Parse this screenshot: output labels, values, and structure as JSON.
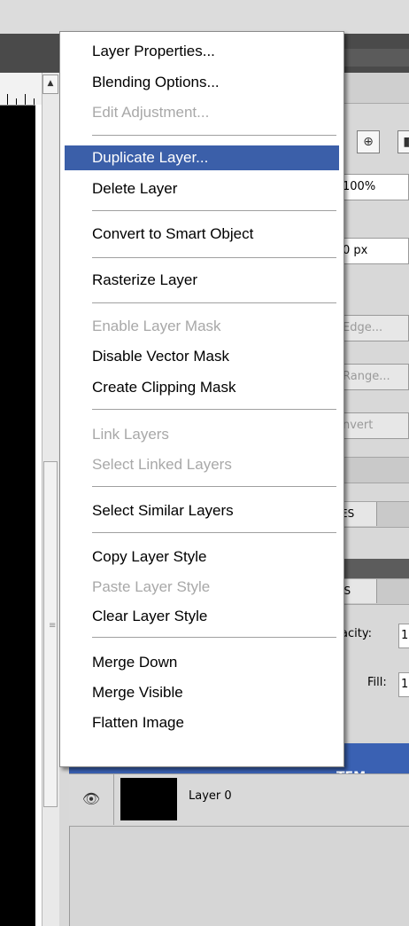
{
  "context_menu": {
    "items": [
      {
        "label": "Layer Properties...",
        "enabled": true
      },
      {
        "label": "Blending Options...",
        "enabled": true
      },
      {
        "label": "Edit Adjustment...",
        "enabled": false
      },
      {
        "label": "Duplicate Layer...",
        "enabled": true,
        "highlighted": true
      },
      {
        "label": "Delete Layer",
        "enabled": true
      },
      {
        "label": "Convert to Smart Object",
        "enabled": true
      },
      {
        "label": "Rasterize Layer",
        "enabled": true
      },
      {
        "label": "Enable Layer Mask",
        "enabled": false
      },
      {
        "label": "Disable Vector Mask",
        "enabled": true
      },
      {
        "label": "Create Clipping Mask",
        "enabled": true
      },
      {
        "label": "Link Layers",
        "enabled": false
      },
      {
        "label": "Select Linked Layers",
        "enabled": false
      },
      {
        "label": "Select Similar Layers",
        "enabled": true
      },
      {
        "label": "Copy Layer Style",
        "enabled": true
      },
      {
        "label": "Paste Layer Style",
        "enabled": false
      },
      {
        "label": "Clear Layer Style",
        "enabled": true
      },
      {
        "label": "Merge Down",
        "enabled": true
      },
      {
        "label": "Merge Visible",
        "enabled": true
      },
      {
        "label": "Flatten Image",
        "enabled": true
      }
    ]
  },
  "panel": {
    "zoom_field": "100%",
    "px_field": "0 px",
    "edge_button": "Edge...",
    "range_button": "Range...",
    "invert_label": "nvert",
    "tab_1": "ES",
    "tab_2": "IS",
    "opacity_label": "acity:",
    "opacity_value": "1",
    "fill_label": "Fill:",
    "fill_value": "1"
  },
  "layers": {
    "selected_layer_name": "TEM",
    "layer0_name": "Layer 0"
  },
  "colors": {
    "highlight": "#3b5fa9",
    "disabled_text": "#a8a8a8",
    "selected_layer_row": "#3a61b3"
  },
  "icons": {
    "eye": "eye-icon",
    "scroll_up": "scroll-up-arrow-icon"
  }
}
